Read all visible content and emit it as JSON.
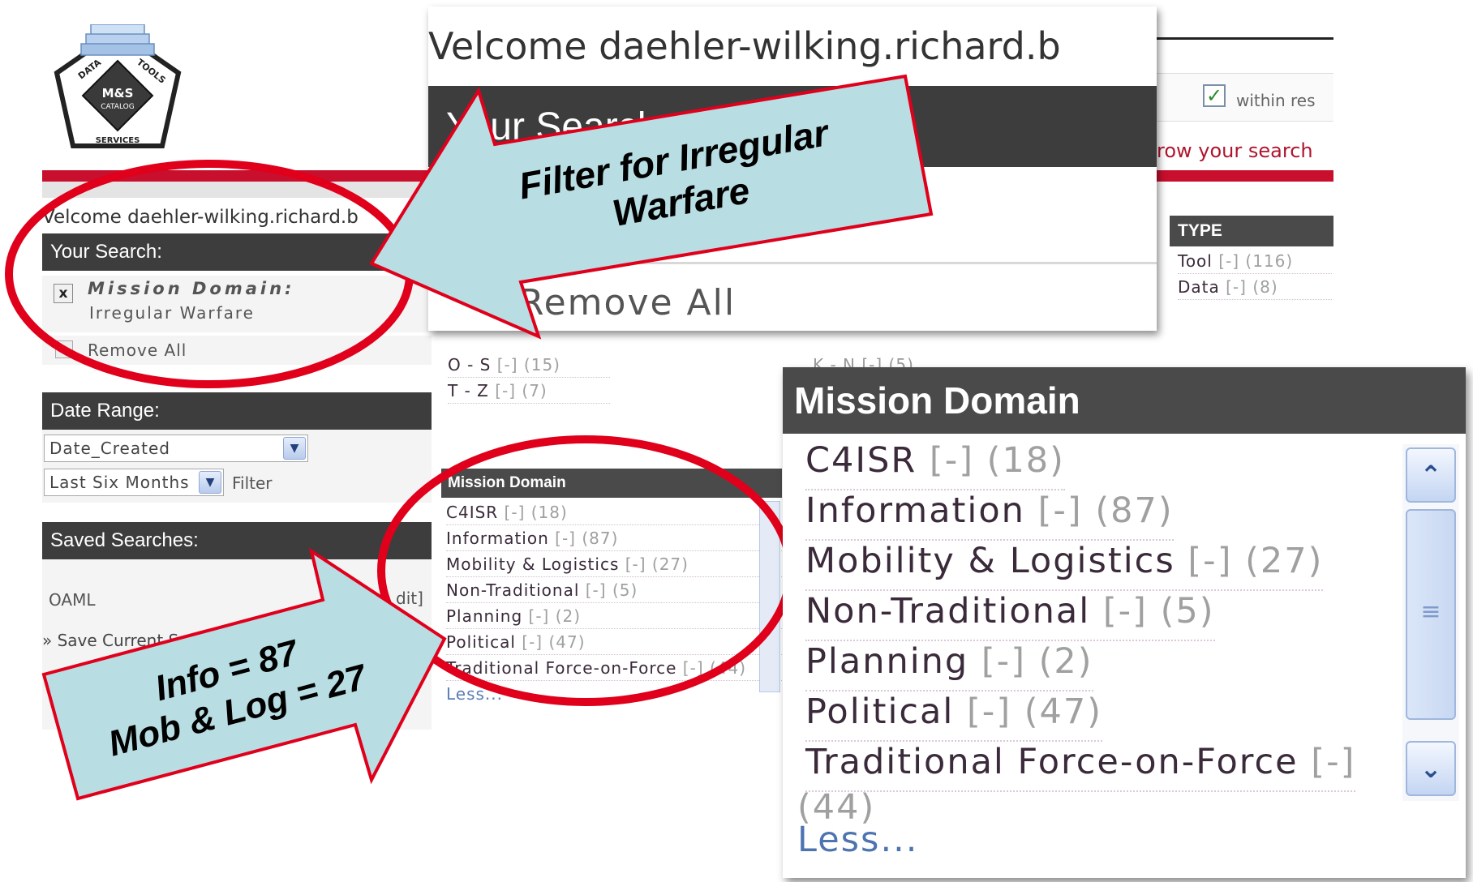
{
  "logo": {
    "top_left": "DATA",
    "top_right": "TOOLS",
    "center_1": "M&S",
    "center_2": "CATALOG",
    "bottom": "SERVICES"
  },
  "base": {
    "welcome": "Velcome daehler-wilking.richard.b",
    "your_search": "Your Search:",
    "filter_label": "Mission Domain:",
    "filter_value": "Irregular Warfare",
    "remove_x": "x",
    "remove_all": "Remove All",
    "date_range": "Date Range:",
    "date_select": "Date_Created",
    "period_select": "Last Six Months",
    "filter_button": "Filter",
    "saved_searches": "Saved Searches:",
    "saved_item": "OAML",
    "saved_edit": "dit]",
    "save_current": "» Save Current S",
    "within_results": "within res",
    "narrow_search": "row your search",
    "type_header": "TYPE",
    "type_items": [
      {
        "name": "Tool",
        "link": "[-]",
        "count": "(116)"
      },
      {
        "name": "Data",
        "link": "[-]",
        "count": "(8)"
      }
    ],
    "alpha_items": [
      {
        "name": "O - S",
        "link": "[-]",
        "count": "(15)"
      },
      {
        "name": "T - Z",
        "link": "[-]",
        "count": "(7)"
      }
    ],
    "alpha_right": "K - N [-] (5)",
    "mission_header": "Mission Domain",
    "mission_items": [
      {
        "name": "C4ISR",
        "link": "[-]",
        "count": "(18)"
      },
      {
        "name": "Information",
        "link": "[-]",
        "count": "(87)"
      },
      {
        "name": "Mobility & Logistics",
        "link": "[-]",
        "count": "(27)"
      },
      {
        "name": "Non-Traditional",
        "link": "[-]",
        "count": "(5)"
      },
      {
        "name": "Planning",
        "link": "[-]",
        "count": "(2)"
      },
      {
        "name": "Political",
        "link": "[-]",
        "count": "(47)"
      },
      {
        "name": "Traditional Force-on-Force",
        "link": "[-]",
        "count": "(44)"
      }
    ],
    "less": "Less..."
  },
  "zoom_top": {
    "welcome": "Velcome daehler-wilking.richard.b",
    "your_search": "Your Search:",
    "remove_all": "Remove All"
  },
  "zoom_mission": {
    "header": "Mission Domain",
    "items": [
      {
        "name": "C4ISR",
        "link": "[-]",
        "count": "(18)"
      },
      {
        "name": "Information",
        "link": "[-]",
        "count": "(87)"
      },
      {
        "name": "Mobility & Logistics",
        "link": "[-]",
        "count": "(27)"
      },
      {
        "name": "Non-Traditional",
        "link": "[-]",
        "count": "(5)"
      },
      {
        "name": "Planning",
        "link": "[-]",
        "count": "(2)"
      },
      {
        "name": "Political",
        "link": "[-]",
        "count": "(47)"
      },
      {
        "name": "Traditional Force-on-Force",
        "link": "[-]",
        "count": ""
      }
    ],
    "overflow_count": "(44)",
    "less": "Less..."
  },
  "callouts": {
    "filter_line1": "Filter for Irregular",
    "filter_line2": "Warfare",
    "info_line1": "Info = 87",
    "info_line2": "Mob & Log = 27"
  },
  "colors": {
    "accent_red": "#c8102e",
    "header_dark": "#3d3d3d",
    "callout_fill": "#b8dde3",
    "highlight_red": "#e0001b"
  }
}
